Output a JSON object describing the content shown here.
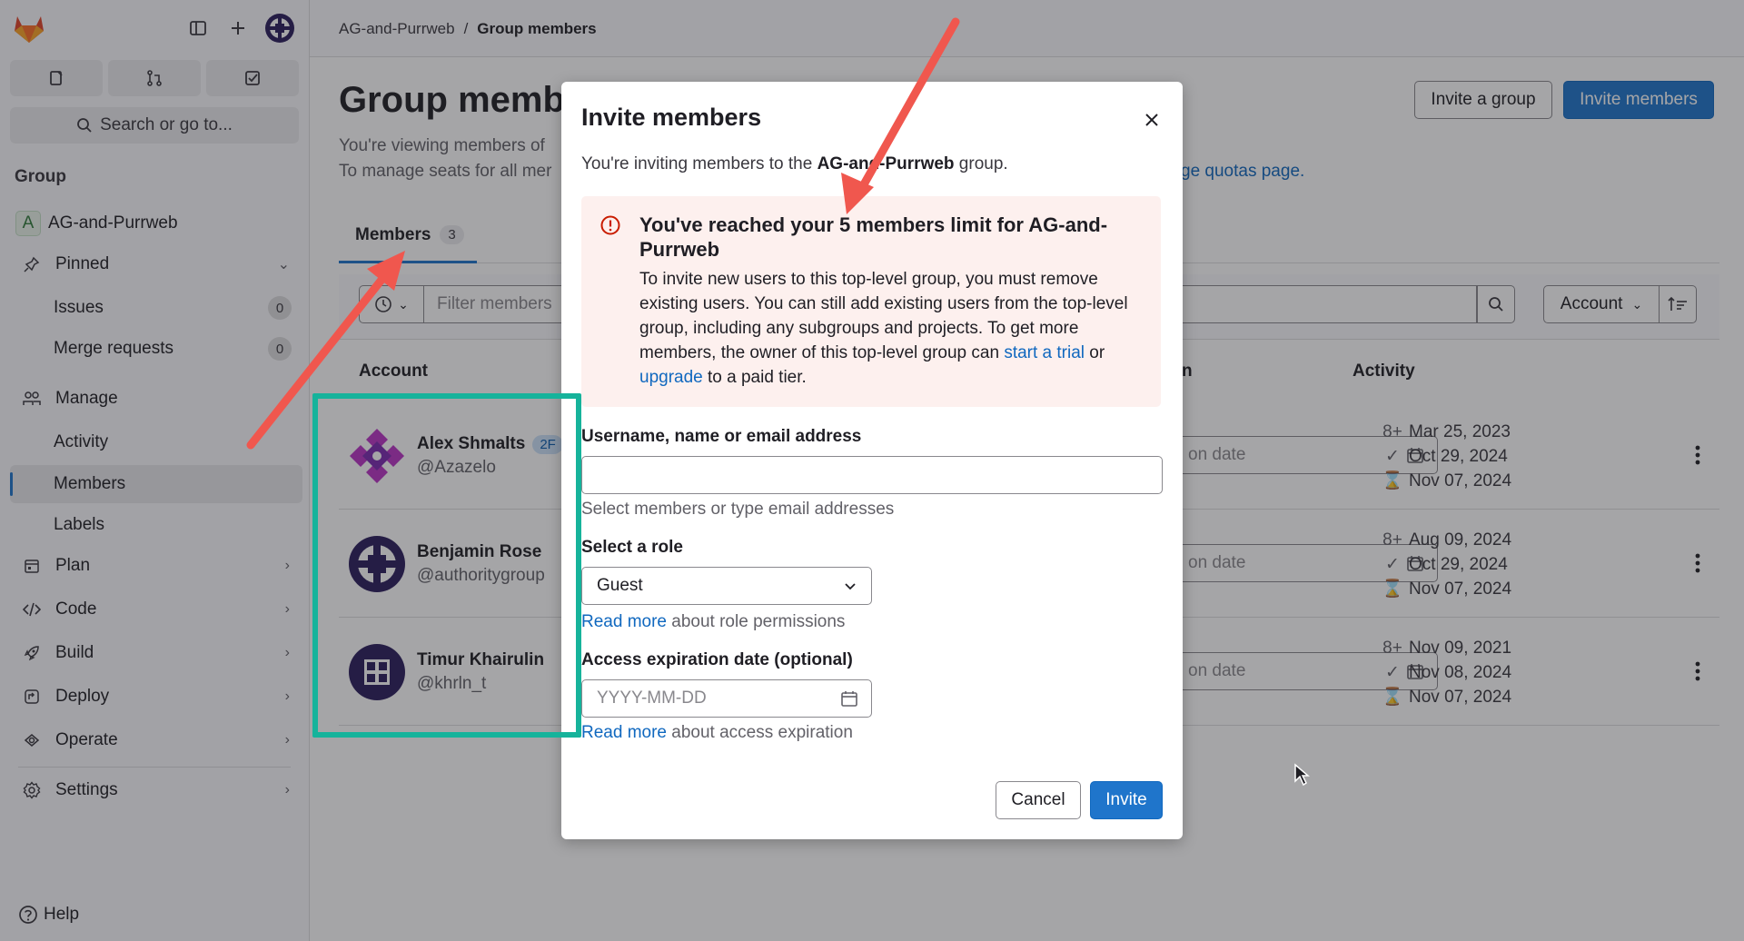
{
  "sidebar": {
    "search_label": "Search or go to...",
    "section_label": "Group",
    "group_name": "AG-and-Purrweb",
    "group_initial": "A",
    "items": {
      "pinned": "Pinned",
      "issues": "Issues",
      "issues_count": "0",
      "merge_requests": "Merge requests",
      "merge_requests_count": "0",
      "manage": "Manage",
      "activity": "Activity",
      "members": "Members",
      "labels": "Labels",
      "plan": "Plan",
      "code": "Code",
      "build": "Build",
      "deploy": "Deploy",
      "operate": "Operate",
      "settings": "Settings"
    },
    "help": "Help"
  },
  "breadcrumb": {
    "group": "AG-and-Purrweb",
    "separator": "/",
    "current": "Group members"
  },
  "page": {
    "title": "Group membe",
    "line1": "You're viewing members of",
    "line2": "To manage seats for all mer",
    "quota_link": "ge quotas page.",
    "invite_group": "Invite a group",
    "invite_members": "Invite members"
  },
  "tabs": {
    "members": "Members",
    "members_count": "3"
  },
  "filter": {
    "placeholder": "Filter members",
    "sort_label": "Account"
  },
  "table": {
    "col_account": "Account",
    "col_expiration_fragment": "n",
    "col_activity": "Activity",
    "date_placeholder_fragment": "on date",
    "rows": [
      {
        "name": "Alex Shmalts",
        "badge": "2F",
        "username": "@Azazelo",
        "created": "Mar 25, 2023",
        "last_activity": "Oct 29, 2024",
        "expires": "Nov 07, 2024"
      },
      {
        "name": "Benjamin Rose",
        "badge": "",
        "username": "@authoritygroup",
        "created": "Aug 09, 2024",
        "last_activity": "Oct 29, 2024",
        "expires": "Nov 07, 2024"
      },
      {
        "name": "Timur Khairulin",
        "badge": "",
        "username": "@khrln_t",
        "created": "Nov 09, 2021",
        "last_activity": "Nov 08, 2024",
        "expires": "Nov 07, 2024"
      }
    ]
  },
  "modal": {
    "title": "Invite members",
    "intro_before": "You're inviting members to the ",
    "intro_group": "AG-and-Purrweb",
    "intro_after": " group.",
    "alert_title": "You've reached your 5 members limit for AG-and-Purrweb",
    "alert_body_1": "To invite new users to this top-level group, you must remove existing users. You can still add existing users from the top-level group, including any subgroups and projects. To get more members, the owner of this top-level group can ",
    "alert_link_trial": "start a trial",
    "alert_body_2": " or ",
    "alert_link_upgrade": "upgrade",
    "alert_body_3": " to a paid tier.",
    "username_label": "Username, name or email address",
    "username_help": "Select members or type email addresses",
    "role_label": "Select a role",
    "role_value": "Guest",
    "role_link": "Read more",
    "role_help": " about role permissions",
    "expiration_label": "Access expiration date (optional)",
    "expiration_placeholder": "YYYY-MM-DD",
    "expiration_link": "Read more",
    "expiration_help": " about access expiration",
    "cancel": "Cancel",
    "invite": "Invite"
  },
  "colors": {
    "primary": "#1f75cb",
    "annotation_arrow": "#f0574e",
    "annotation_box": "#16b39b",
    "alert_bg": "#fdf0ee",
    "alert_icon": "#c91c00"
  }
}
